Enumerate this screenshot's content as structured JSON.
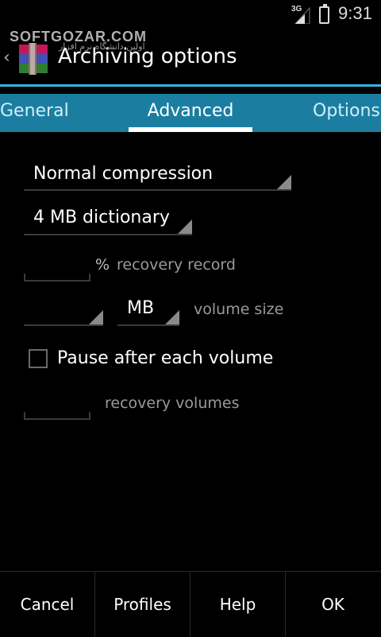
{
  "status_bar": {
    "network": "3G",
    "time": "9:31",
    "icons": [
      "signal-icon",
      "battery-icon"
    ]
  },
  "watermark": {
    "brand": "SOFTGOZAR.COM",
    "tagline": "اولین دانشگاه نرم افزار"
  },
  "header": {
    "title": "Archiving options",
    "icons": [
      "back-icon",
      "winrar-app-icon"
    ]
  },
  "tabs": [
    {
      "label": "General",
      "selected": false
    },
    {
      "label": "Advanced",
      "selected": true
    },
    {
      "label": "Options",
      "selected": false
    }
  ],
  "form": {
    "compression": "Normal compression",
    "dictionary": "4 MB dictionary",
    "recovery_record": {
      "value": "",
      "unit": "%",
      "label": "recovery record"
    },
    "volume": {
      "value": "",
      "unit": "MB",
      "label": "volume size"
    },
    "pause_after_volume": {
      "checked": false,
      "label": "Pause after each volume"
    },
    "recovery_volumes": {
      "value": "",
      "label": "recovery volumes"
    }
  },
  "buttons": {
    "cancel": "Cancel",
    "profiles": "Profiles",
    "help": "Help",
    "ok": "OK"
  },
  "colors": {
    "accent": "#34b5e5",
    "tab_bar": "#1b7ea1",
    "background": "#000000"
  }
}
